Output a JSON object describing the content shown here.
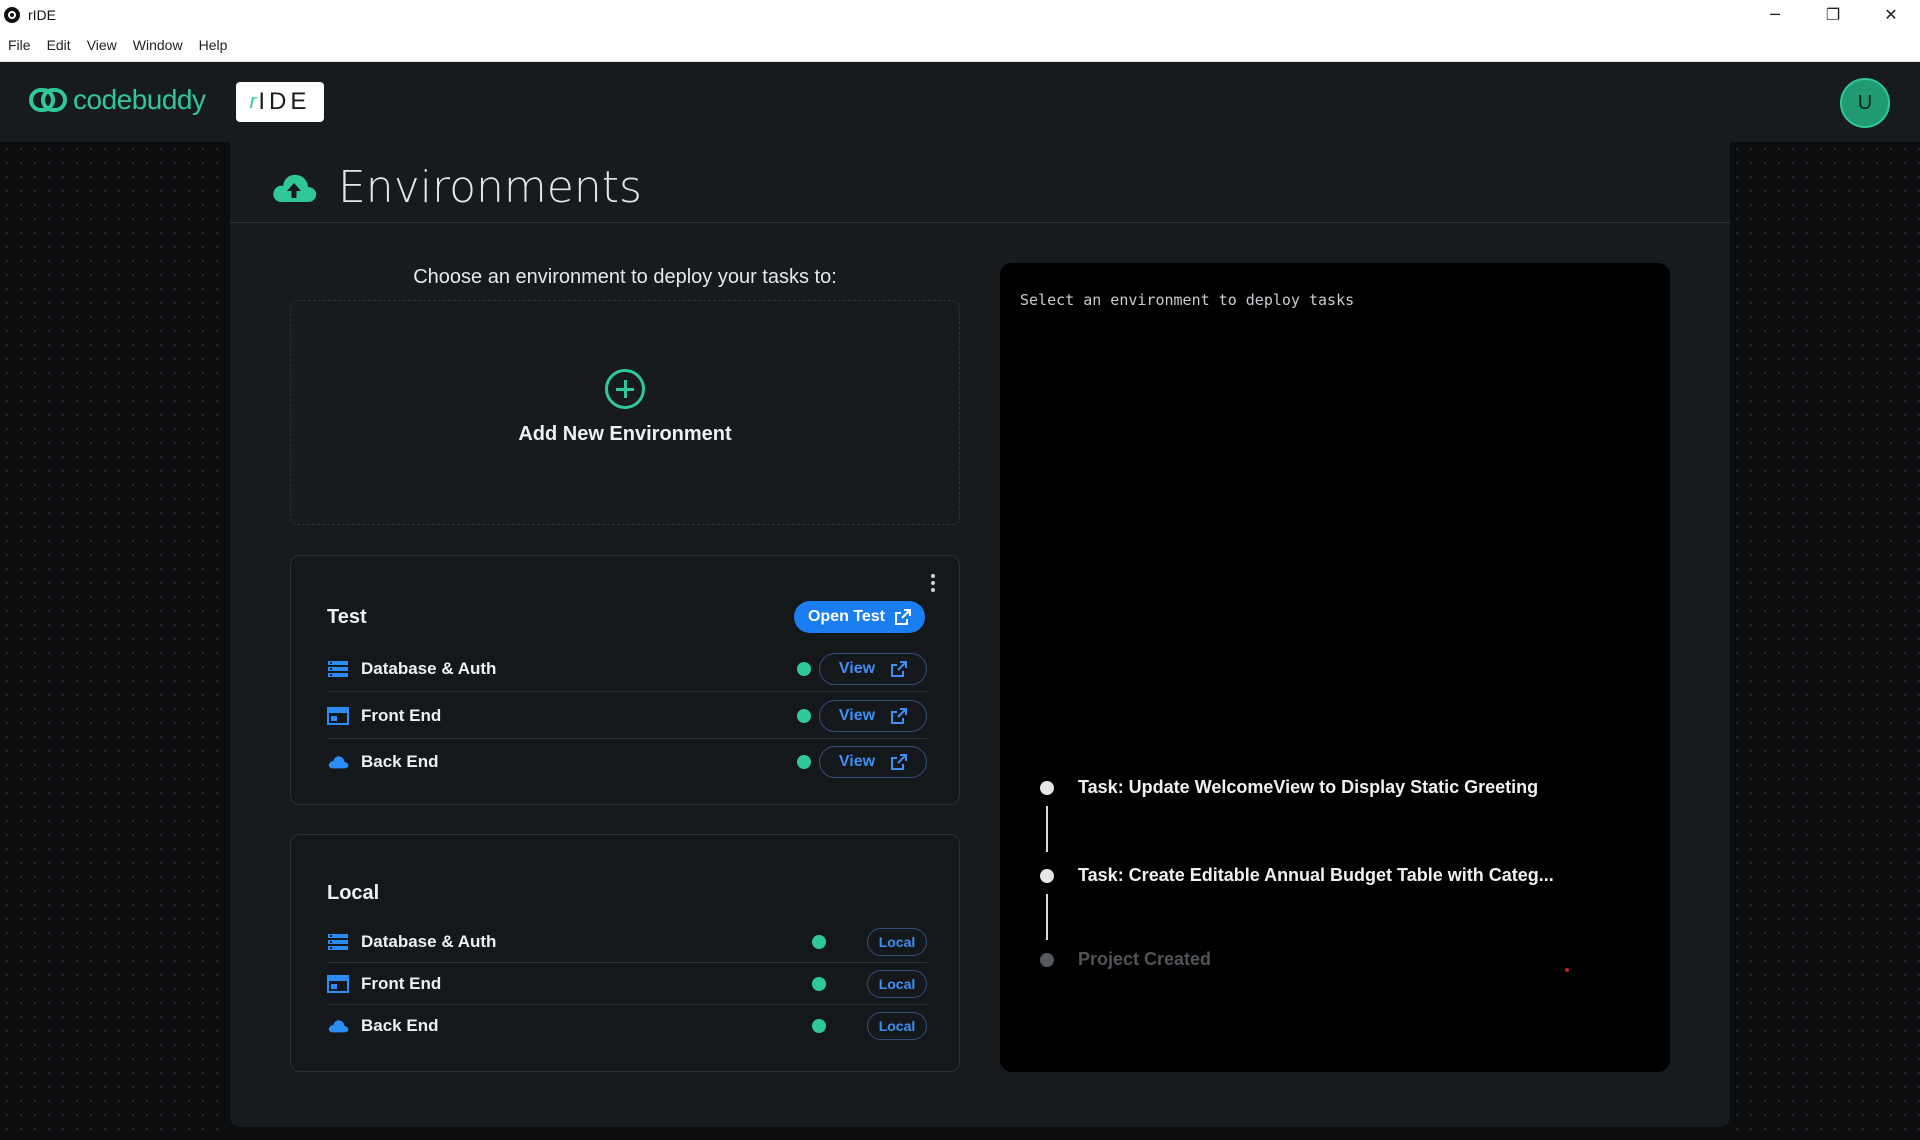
{
  "window": {
    "title": "rIDE",
    "controls": {
      "minimize": "─",
      "restore": "❐",
      "close": "✕"
    }
  },
  "menu": [
    "File",
    "Edit",
    "View",
    "Window",
    "Help"
  ],
  "header": {
    "brand": "codebuddy",
    "badge": "IDE",
    "badge_mark": "r",
    "avatar_initial": "U"
  },
  "page": {
    "title": "Environments",
    "choose_text": "Choose an environment to deploy your tasks to:",
    "add_label": "Add New Environment"
  },
  "environments": [
    {
      "name": "Test",
      "open_label": "Open Test",
      "services": [
        {
          "label": "Database & Auth",
          "icon": "database-icon",
          "action": "View"
        },
        {
          "label": "Front End",
          "icon": "browser-window-icon",
          "action": "View"
        },
        {
          "label": "Back End",
          "icon": "cloud-icon",
          "action": "View"
        }
      ]
    },
    {
      "name": "Local",
      "services": [
        {
          "label": "Database & Auth",
          "icon": "database-icon",
          "action": "Local"
        },
        {
          "label": "Front End",
          "icon": "browser-window-icon",
          "action": "Local"
        },
        {
          "label": "Back End",
          "icon": "cloud-icon",
          "action": "Local"
        }
      ]
    }
  ],
  "deploy": {
    "hint": "Select an environment to deploy tasks",
    "timeline": [
      "Task: Update WelcomeView to Display Static Greeting",
      "Task: Create Editable Annual Budget Table with Categ...",
      "Project Created"
    ]
  },
  "colors": {
    "accent": "#2fc896",
    "blue": "#1a7ef2",
    "status": "#2fc896"
  }
}
